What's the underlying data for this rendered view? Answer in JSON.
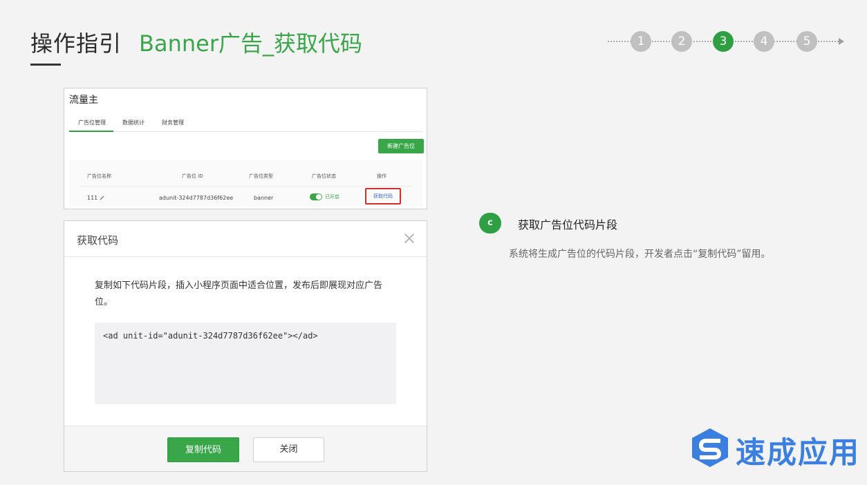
{
  "header": {
    "title": "操作指引",
    "subtitle": "Banner广告_获取代码"
  },
  "steps": [
    "1",
    "2",
    "3",
    "4",
    "5"
  ],
  "active_step": "3",
  "colors": {
    "accent": "#3aa64a",
    "step_active": "#2ea043",
    "step_inactive": "#c0c0c0",
    "highlight_border": "#d62c2c",
    "link": "#3b6fd1",
    "logo": "#3b7fe0"
  },
  "admin": {
    "app_name": "流量主",
    "tabs": [
      "广告位管理",
      "数据统计",
      "财务管理"
    ],
    "active_tab": "广告位管理",
    "new_button": "新建广告位",
    "columns": [
      "广告位名称",
      "广告位 ID",
      "广告位类型",
      "广告位状态",
      "操作"
    ],
    "row": {
      "name": "111",
      "id": "adunit-324d7787d36f62ee",
      "type": "banner",
      "status": "已开启",
      "action": "获取代码"
    }
  },
  "dialog": {
    "title": "获取代码",
    "description": "复制如下代码片段，插入小程序页面中适合位置，发布后即展现对应广告位。",
    "code": "<ad unit-id=\"adunit-324d7787d36f62ee\"></ad>",
    "copy_button": "复制代码",
    "close_button": "关闭"
  },
  "explain": {
    "badge": "c",
    "title": "获取广告位代码片段",
    "description": "系统将生成广告位的代码片段，开发者点击“复制代码”留用。"
  },
  "logo": {
    "text": "速成应用",
    "icon": "brand-s-logo-icon"
  }
}
